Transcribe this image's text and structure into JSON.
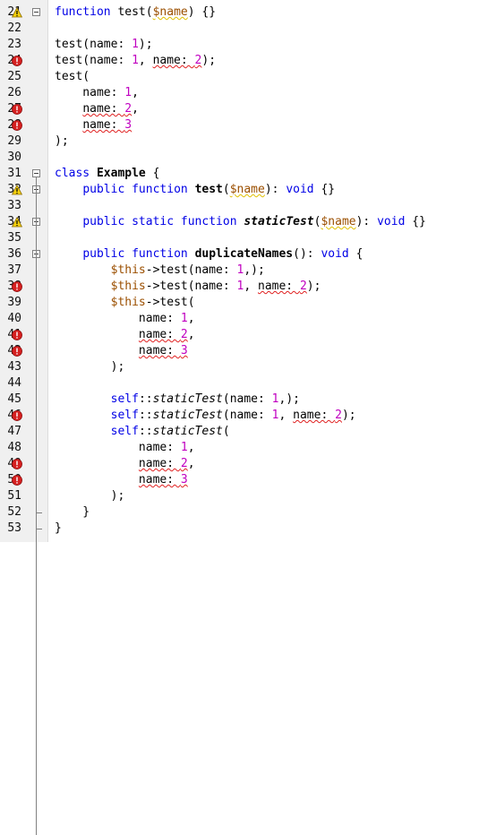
{
  "editor": {
    "top_cut_line_number": "20",
    "lines": [
      {
        "number": "21",
        "annotation": "warning",
        "fold": "open",
        "tokens": [
          {
            "t": "function",
            "c": "kw"
          },
          {
            "t": " test(",
            "c": "plain"
          },
          {
            "t": "$name",
            "c": "var",
            "u": "warn"
          },
          {
            "t": ") {}",
            "c": "plain"
          }
        ]
      },
      {
        "number": "22",
        "tokens": []
      },
      {
        "number": "23",
        "tokens": [
          {
            "t": "test(name: ",
            "c": "plain"
          },
          {
            "t": "1",
            "c": "num"
          },
          {
            "t": ");",
            "c": "plain"
          }
        ]
      },
      {
        "number": "24",
        "annotation": "error",
        "tokens": [
          {
            "t": "test(name: ",
            "c": "plain"
          },
          {
            "t": "1",
            "c": "num"
          },
          {
            "t": ", ",
            "c": "plain"
          },
          {
            "t": "name: ",
            "c": "plain",
            "u": "error"
          },
          {
            "t": "2",
            "c": "num",
            "u": "error"
          },
          {
            "t": ");",
            "c": "plain"
          }
        ]
      },
      {
        "number": "25",
        "tokens": [
          {
            "t": "test(",
            "c": "plain"
          }
        ]
      },
      {
        "number": "26",
        "tokens": [
          {
            "t": "    name: ",
            "c": "plain"
          },
          {
            "t": "1",
            "c": "num"
          },
          {
            "t": ",",
            "c": "plain"
          }
        ]
      },
      {
        "number": "27",
        "annotation": "error",
        "tokens": [
          {
            "t": "    ",
            "c": "plain"
          },
          {
            "t": "name: ",
            "c": "plain",
            "u": "error"
          },
          {
            "t": "2",
            "c": "num",
            "u": "error"
          },
          {
            "t": ",",
            "c": "plain"
          }
        ]
      },
      {
        "number": "28",
        "annotation": "error",
        "tokens": [
          {
            "t": "    ",
            "c": "plain"
          },
          {
            "t": "name: ",
            "c": "plain",
            "u": "error"
          },
          {
            "t": "3",
            "c": "num",
            "u": "error"
          }
        ]
      },
      {
        "number": "29",
        "tokens": [
          {
            "t": ");",
            "c": "plain"
          }
        ]
      },
      {
        "number": "30",
        "tokens": []
      },
      {
        "number": "31",
        "fold": "open",
        "tokens": [
          {
            "t": "class",
            "c": "kw"
          },
          {
            "t": " ",
            "c": "plain"
          },
          {
            "t": "Example",
            "c": "bold"
          },
          {
            "t": " {",
            "c": "plain"
          }
        ]
      },
      {
        "number": "32",
        "annotation": "warning",
        "fold": "open",
        "tokens": [
          {
            "t": "    ",
            "c": "plain"
          },
          {
            "t": "public",
            "c": "kw"
          },
          {
            "t": " ",
            "c": "plain"
          },
          {
            "t": "function",
            "c": "kw"
          },
          {
            "t": " ",
            "c": "plain"
          },
          {
            "t": "test",
            "c": "bold"
          },
          {
            "t": "(",
            "c": "plain"
          },
          {
            "t": "$name",
            "c": "var",
            "u": "warn"
          },
          {
            "t": "): ",
            "c": "plain"
          },
          {
            "t": "void",
            "c": "kw"
          },
          {
            "t": " {}",
            "c": "plain"
          }
        ]
      },
      {
        "number": "33",
        "tokens": []
      },
      {
        "number": "34",
        "annotation": "warning",
        "fold": "open",
        "tokens": [
          {
            "t": "    ",
            "c": "plain"
          },
          {
            "t": "public",
            "c": "kw"
          },
          {
            "t": " ",
            "c": "plain"
          },
          {
            "t": "static",
            "c": "kw"
          },
          {
            "t": " ",
            "c": "plain"
          },
          {
            "t": "function",
            "c": "kw"
          },
          {
            "t": " ",
            "c": "plain"
          },
          {
            "t": "staticTest",
            "c": "bolditalic"
          },
          {
            "t": "(",
            "c": "plain"
          },
          {
            "t": "$name",
            "c": "var",
            "u": "warn"
          },
          {
            "t": "): ",
            "c": "plain"
          },
          {
            "t": "void",
            "c": "kw"
          },
          {
            "t": " {}",
            "c": "plain"
          }
        ]
      },
      {
        "number": "35",
        "tokens": []
      },
      {
        "number": "36",
        "fold": "open",
        "tokens": [
          {
            "t": "    ",
            "c": "plain"
          },
          {
            "t": "public",
            "c": "kw"
          },
          {
            "t": " ",
            "c": "plain"
          },
          {
            "t": "function",
            "c": "kw"
          },
          {
            "t": " ",
            "c": "plain"
          },
          {
            "t": "duplicateNames",
            "c": "bold"
          },
          {
            "t": "(): ",
            "c": "plain"
          },
          {
            "t": "void",
            "c": "kw"
          },
          {
            "t": " {",
            "c": "plain"
          }
        ]
      },
      {
        "number": "37",
        "tokens": [
          {
            "t": "        ",
            "c": "plain"
          },
          {
            "t": "$this",
            "c": "var"
          },
          {
            "t": "->test(name: ",
            "c": "plain"
          },
          {
            "t": "1",
            "c": "num"
          },
          {
            "t": ",);",
            "c": "plain"
          }
        ]
      },
      {
        "number": "38",
        "annotation": "error",
        "tokens": [
          {
            "t": "        ",
            "c": "plain"
          },
          {
            "t": "$this",
            "c": "var"
          },
          {
            "t": "->test(name: ",
            "c": "plain"
          },
          {
            "t": "1",
            "c": "num"
          },
          {
            "t": ", ",
            "c": "plain"
          },
          {
            "t": "name: ",
            "c": "plain",
            "u": "error"
          },
          {
            "t": "2",
            "c": "num",
            "u": "error"
          },
          {
            "t": ");",
            "c": "plain"
          }
        ]
      },
      {
        "number": "39",
        "tokens": [
          {
            "t": "        ",
            "c": "plain"
          },
          {
            "t": "$this",
            "c": "var"
          },
          {
            "t": "->test(",
            "c": "plain"
          }
        ]
      },
      {
        "number": "40",
        "tokens": [
          {
            "t": "            name: ",
            "c": "plain"
          },
          {
            "t": "1",
            "c": "num"
          },
          {
            "t": ",",
            "c": "plain"
          }
        ]
      },
      {
        "number": "41",
        "annotation": "error",
        "tokens": [
          {
            "t": "            ",
            "c": "plain"
          },
          {
            "t": "name: ",
            "c": "plain",
            "u": "error"
          },
          {
            "t": "2",
            "c": "num",
            "u": "error"
          },
          {
            "t": ",",
            "c": "plain"
          }
        ]
      },
      {
        "number": "42",
        "annotation": "error",
        "tokens": [
          {
            "t": "            ",
            "c": "plain"
          },
          {
            "t": "name: ",
            "c": "plain",
            "u": "error"
          },
          {
            "t": "3",
            "c": "num",
            "u": "error"
          }
        ]
      },
      {
        "number": "43",
        "tokens": [
          {
            "t": "        );",
            "c": "plain"
          }
        ]
      },
      {
        "number": "44",
        "tokens": []
      },
      {
        "number": "45",
        "tokens": [
          {
            "t": "        ",
            "c": "plain"
          },
          {
            "t": "self",
            "c": "kw"
          },
          {
            "t": "::",
            "c": "plain"
          },
          {
            "t": "staticTest",
            "c": "italic"
          },
          {
            "t": "(name: ",
            "c": "plain"
          },
          {
            "t": "1",
            "c": "num"
          },
          {
            "t": ",);",
            "c": "plain"
          }
        ]
      },
      {
        "number": "46",
        "annotation": "error",
        "tokens": [
          {
            "t": "        ",
            "c": "plain"
          },
          {
            "t": "self",
            "c": "kw"
          },
          {
            "t": "::",
            "c": "plain"
          },
          {
            "t": "staticTest",
            "c": "italic"
          },
          {
            "t": "(name: ",
            "c": "plain"
          },
          {
            "t": "1",
            "c": "num"
          },
          {
            "t": ", ",
            "c": "plain"
          },
          {
            "t": "name: ",
            "c": "plain",
            "u": "error"
          },
          {
            "t": "2",
            "c": "num",
            "u": "error"
          },
          {
            "t": ");",
            "c": "plain"
          }
        ]
      },
      {
        "number": "47",
        "tokens": [
          {
            "t": "        ",
            "c": "plain"
          },
          {
            "t": "self",
            "c": "kw"
          },
          {
            "t": "::",
            "c": "plain"
          },
          {
            "t": "staticTest",
            "c": "italic"
          },
          {
            "t": "(",
            "c": "plain"
          }
        ]
      },
      {
        "number": "48",
        "tokens": [
          {
            "t": "            name: ",
            "c": "plain"
          },
          {
            "t": "1",
            "c": "num"
          },
          {
            "t": ",",
            "c": "plain"
          }
        ]
      },
      {
        "number": "49",
        "annotation": "error",
        "tokens": [
          {
            "t": "            ",
            "c": "plain"
          },
          {
            "t": "name: ",
            "c": "plain",
            "u": "error"
          },
          {
            "t": "2",
            "c": "num",
            "u": "error"
          },
          {
            "t": ",",
            "c": "plain"
          }
        ]
      },
      {
        "number": "50",
        "annotation": "error",
        "tokens": [
          {
            "t": "            ",
            "c": "plain"
          },
          {
            "t": "name: ",
            "c": "plain",
            "u": "error"
          },
          {
            "t": "3",
            "c": "num",
            "u": "error"
          }
        ]
      },
      {
        "number": "51",
        "tokens": [
          {
            "t": "        );",
            "c": "plain"
          }
        ]
      },
      {
        "number": "52",
        "fold": "end",
        "tokens": [
          {
            "t": "    }",
            "c": "plain"
          }
        ]
      },
      {
        "number": "53",
        "fold": "end",
        "tokens": [
          {
            "t": "}",
            "c": "plain"
          }
        ]
      }
    ]
  },
  "colors": {
    "keyword": "#0000e6",
    "variable": "#9b4f00",
    "number": "#c000c0",
    "warning": "#e0c000",
    "error": "#e02020"
  }
}
